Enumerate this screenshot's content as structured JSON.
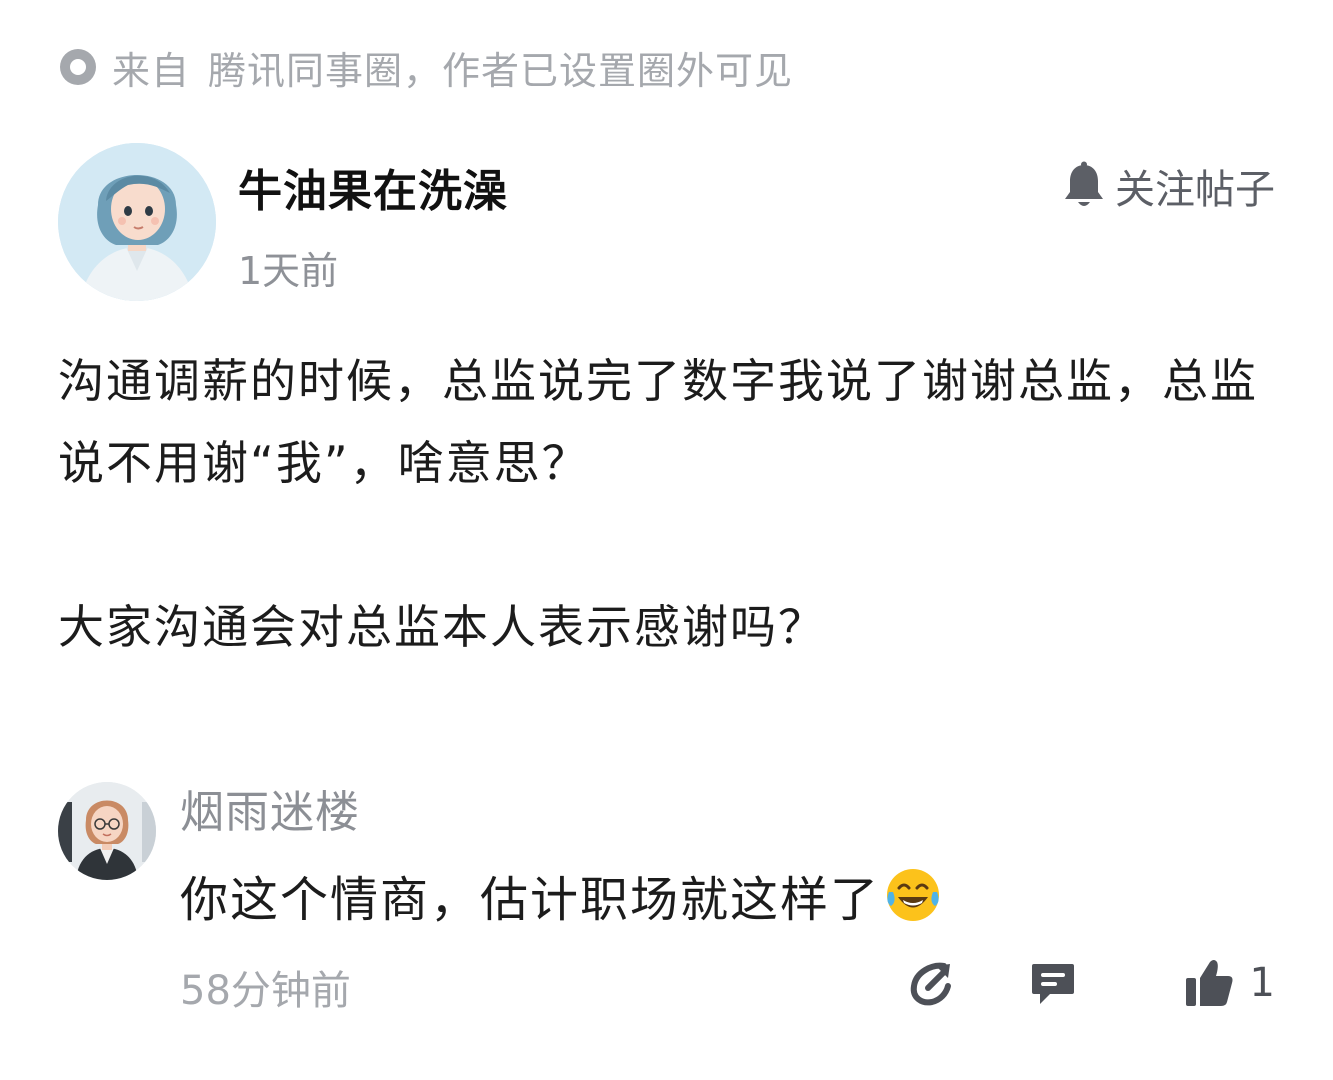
{
  "source": {
    "prefix": "来自",
    "text": "腾讯同事圈，作者已设置圈外可见",
    "icon": "circle-dot-icon"
  },
  "post": {
    "author": "牛油果在洗澡",
    "time": "1天前",
    "follow_label": "关注帖子",
    "paragraphs": [
      "沟通调薪的时候，总监说完了数字我说了谢谢总监，总监说不用谢“我”，啥意思？",
      "大家沟通会对总监本人表示感谢吗？"
    ]
  },
  "comment": {
    "author": "烟雨迷楼",
    "text": "你这个情商，估计职场就这样了",
    "emoji": "tears-of-joy-emoji",
    "time": "58分钟前",
    "like_count": "1"
  },
  "colors": {
    "muted": "#a5a8ad",
    "text": "#1c1c1c",
    "icon": "#4d5057"
  }
}
